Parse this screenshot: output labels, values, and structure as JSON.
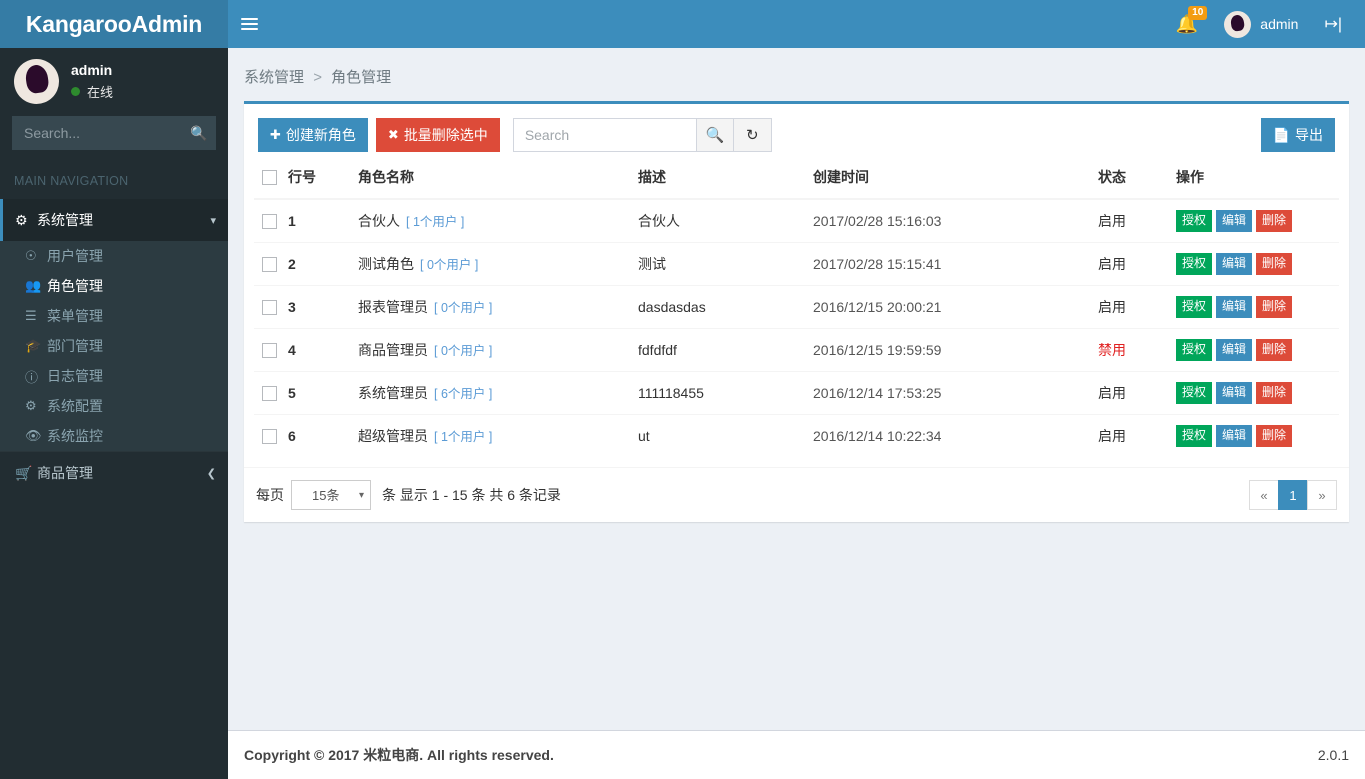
{
  "brand": {
    "title": "KangarooAdmin"
  },
  "header": {
    "toggle_icon": "hamburger-icon",
    "notification_count": "10",
    "user_name": "admin",
    "logout_icon": "logout-icon"
  },
  "sidebar": {
    "user": {
      "name": "admin",
      "status": "在线"
    },
    "search_placeholder": "Search...",
    "nav_header": "MAIN NAVIGATION",
    "items": [
      {
        "label": "系统管理",
        "icon": "gears-icon",
        "chevron": "chevron-down-icon",
        "active": true
      },
      {
        "label": "商品管理",
        "icon": "cart-icon",
        "chevron": "chevron-left-icon",
        "active": false
      }
    ],
    "submenu": [
      {
        "label": "用户管理",
        "icon": "user-circle-icon"
      },
      {
        "label": "角色管理",
        "icon": "users-icon"
      },
      {
        "label": "菜单管理",
        "icon": "list-icon"
      },
      {
        "label": "部门管理",
        "icon": "graduation-cap-icon"
      },
      {
        "label": "日志管理",
        "icon": "info-circle-icon"
      },
      {
        "label": "系统配置",
        "icon": "gear-icon"
      },
      {
        "label": "系统监控",
        "icon": "eye-icon"
      }
    ]
  },
  "breadcrumb": {
    "parent": "系统管理",
    "separator": ">",
    "current": "角色管理"
  },
  "toolbar": {
    "create_label": "创建新角色",
    "create_icon": "plus-icon",
    "batch_delete_label": "批量删除选中",
    "batch_delete_icon": "times-icon",
    "search_placeholder": "Search",
    "search_value": "",
    "search_icon": "search-icon",
    "refresh_icon": "refresh-icon",
    "export_label": "导出",
    "export_icon": "file-excel-icon"
  },
  "table": {
    "columns": [
      "行号",
      "角色名称",
      "描述",
      "创建时间",
      "状态",
      "操作"
    ],
    "actions": {
      "grant": "授权",
      "edit": "编辑",
      "delete": "删除"
    },
    "rows": [
      {
        "no": "1",
        "name": "合伙人",
        "users": "[ 1个用户 ]",
        "desc": "合伙人",
        "time": "2017/02/28 15:16:03",
        "status": "启用",
        "disabled": false
      },
      {
        "no": "2",
        "name": "测试角色",
        "users": "[ 0个用户 ]",
        "desc": "测试",
        "time": "2017/02/28 15:15:41",
        "status": "启用",
        "disabled": false
      },
      {
        "no": "3",
        "name": "报表管理员",
        "users": "[ 0个用户 ]",
        "desc": "dasdasdas",
        "time": "2016/12/15 20:00:21",
        "status": "启用",
        "disabled": false
      },
      {
        "no": "4",
        "name": "商品管理员",
        "users": "[ 0个用户 ]",
        "desc": "fdfdfdf",
        "time": "2016/12/15 19:59:59",
        "status": "禁用",
        "disabled": true
      },
      {
        "no": "5",
        "name": "系统管理员",
        "users": "[ 6个用户 ]",
        "desc": "111118455",
        "time": "2016/12/14 17:53:25",
        "status": "启用",
        "disabled": false
      },
      {
        "no": "6",
        "name": "超级管理员",
        "users": "[ 1个用户 ]",
        "desc": "ut",
        "time": "2016/12/14 10:22:34",
        "status": "启用",
        "disabled": false
      }
    ]
  },
  "pagination": {
    "per_page_prefix": "每页",
    "per_page_value": "15条",
    "per_page_options": [
      "15条"
    ],
    "info": "条 显示 1 - 15 条 共 6 条记录",
    "prev": "«",
    "next": "»",
    "pages": [
      "1"
    ],
    "current_page": "1"
  },
  "footer": {
    "copyright": "Copyright © 2017 米粒电商. All rights reserved.",
    "version": "2.0.1"
  },
  "colors": {
    "primary": "#3c8dbc",
    "primary_dark": "#357ca5",
    "sidebar": "#222d32",
    "sidebar_active": "#1e282c",
    "submenu": "#2c3b41",
    "success": "#00a65a",
    "danger": "#dd4b39",
    "warning": "#f39c12",
    "body_bg": "#ecf0f5"
  }
}
